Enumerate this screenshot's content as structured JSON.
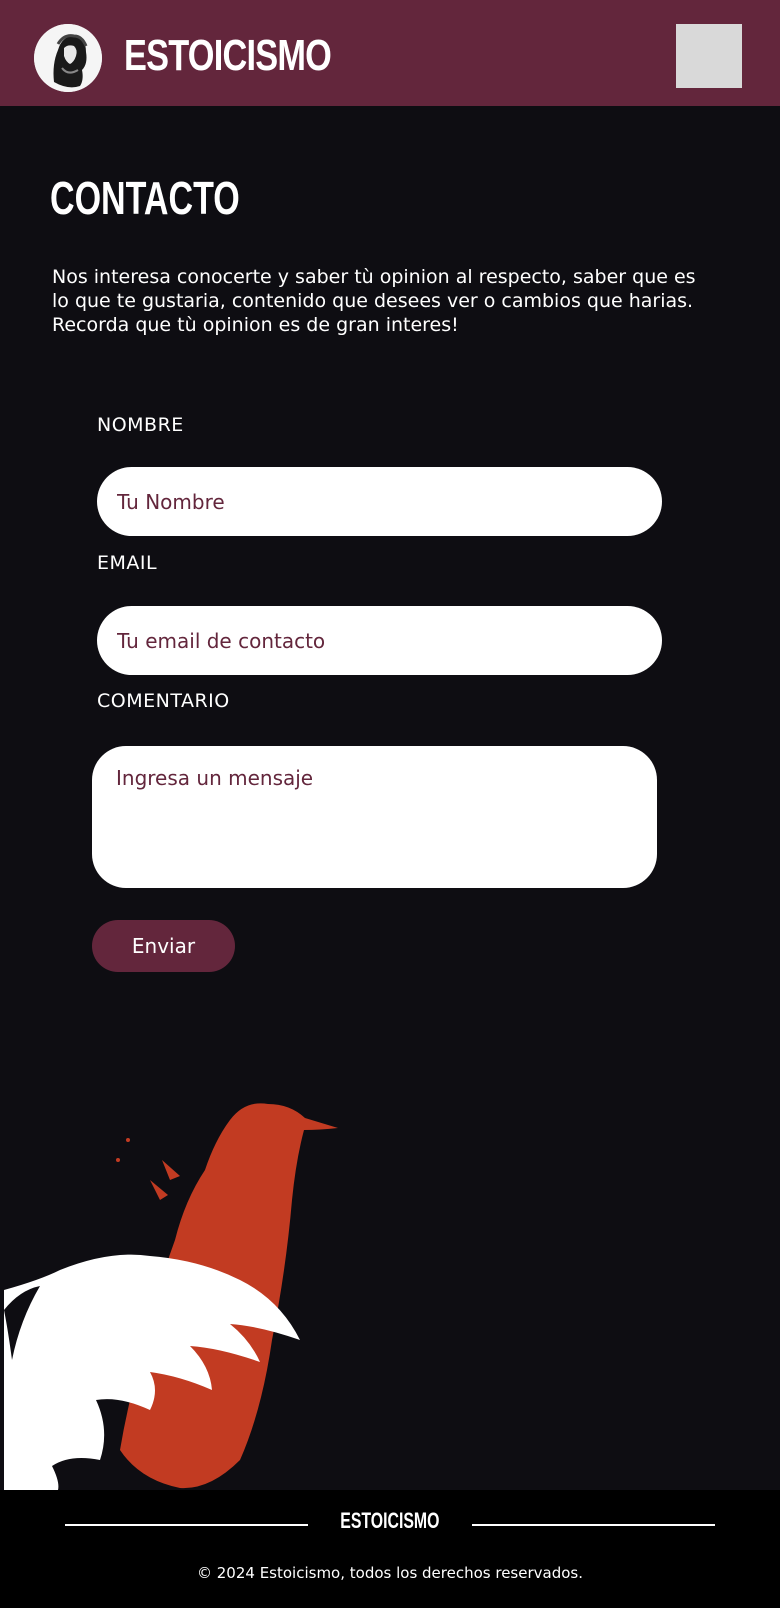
{
  "header": {
    "brand": "ESTOICISMO",
    "logo_icon": "stoic-bust-icon",
    "menu_icon": "menu-icon"
  },
  "page": {
    "title": "CONTACTO",
    "intro": "Nos interesa conocerte y saber tù opinion al respecto, saber que es lo que te gustaria, contenido que desees ver o cambios que harias. Recorda que tù opinion es de gran interes!"
  },
  "form": {
    "name_label": "NOMBRE",
    "name_placeholder": "Tu Nombre",
    "name_value": "",
    "email_label": "EMAIL",
    "email_placeholder": "Tu email de contacto",
    "email_value": "",
    "comment_label": "COMENTARIO",
    "comment_placeholder": "Ingresa un mensaje",
    "comment_value": "",
    "submit_label": "Enviar"
  },
  "footer": {
    "brand": "ESTOICISMO",
    "copyright": "© 2024 Estoicismo, todos los derechos reservados."
  },
  "colors": {
    "brand": "#63263c",
    "background": "#0e0d12",
    "footer": "#000000",
    "crow": "#c23b22"
  }
}
